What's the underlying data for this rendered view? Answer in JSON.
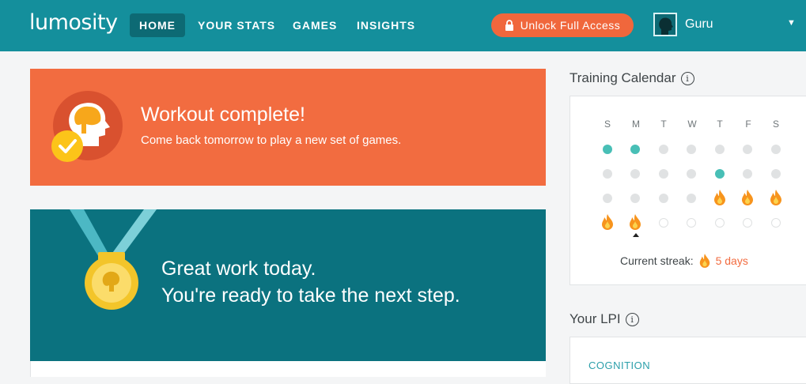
{
  "app": {
    "logo_text": "lumosity"
  },
  "nav": {
    "items": [
      {
        "label": "HOME",
        "active": true
      },
      {
        "label": "YOUR STATS",
        "active": false
      },
      {
        "label": "GAMES",
        "active": false
      },
      {
        "label": "INSIGHTS",
        "active": false
      }
    ]
  },
  "unlock_button": {
    "label": "Unlock Full Access",
    "icon": "lock-icon"
  },
  "user": {
    "name": "Guru",
    "avatar_icon": "head-silhouette-icon",
    "caret_icon": "caret-down-icon"
  },
  "workout": {
    "title": "Workout complete!",
    "subtitle": "Come back tomorrow to play a new set of games.",
    "icon": "brain-head-check-icon",
    "color": "#f26c40"
  },
  "great_work": {
    "line1": "Great work today.",
    "line2": "You're ready to take the next step.",
    "icon": "medal-icon",
    "color": "#0b727f"
  },
  "calendar": {
    "title": "Training Calendar",
    "info_icon": "info-icon",
    "day_labels": [
      "S",
      "M",
      "T",
      "W",
      "T",
      "F",
      "S"
    ],
    "weeks": [
      [
        "done",
        "done",
        "missed",
        "missed",
        "missed",
        "missed",
        "missed"
      ],
      [
        "missed",
        "missed",
        "missed",
        "missed",
        "done",
        "missed",
        "missed"
      ],
      [
        "missed",
        "missed",
        "missed",
        "missed",
        "flame",
        "flame",
        "flame"
      ],
      [
        "flame",
        "flame",
        "future",
        "future",
        "future",
        "future",
        "future"
      ]
    ],
    "streak_label": "Current streak:",
    "streak_value": "5 days",
    "streak_icon": "flame-icon",
    "colors": {
      "done": "#48bfb6",
      "flame": "#f7941d",
      "missed": "#e0e2e3"
    }
  },
  "lpi": {
    "title": "Your LPI",
    "info_icon": "info-icon",
    "first_category": "COGNITION"
  }
}
